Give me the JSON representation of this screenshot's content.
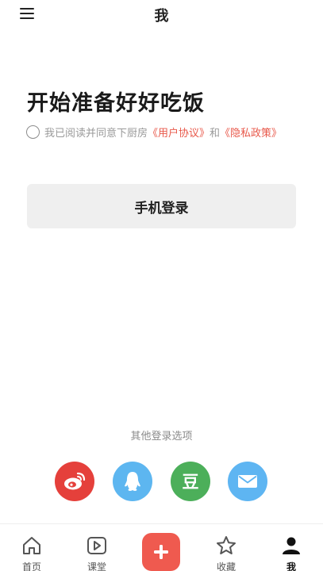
{
  "header": {
    "title": "我",
    "menu_icon": "hamburger-menu-icon"
  },
  "main": {
    "headline": "开始准备好好吃饭",
    "agreement": {
      "prefix": "我已阅读并同意下厨房",
      "user_agreement": "《用户协议》",
      "conjunction": "和",
      "privacy_policy": "《隐私政策》",
      "checked": false
    },
    "login_button": "手机登录",
    "other_login_title": "其他登录选项",
    "social_logins": [
      {
        "name": "weibo",
        "icon": "weibo-icon",
        "color": "#e5403b"
      },
      {
        "name": "qq",
        "icon": "qq-penguin-icon",
        "color": "#5db6f0"
      },
      {
        "name": "douban",
        "icon": "douban-icon",
        "glyph": "豆",
        "color": "#4caf5a"
      },
      {
        "name": "email",
        "icon": "mail-icon",
        "color": "#5eb5f2"
      }
    ]
  },
  "tabbar": {
    "items": [
      {
        "label": "首页",
        "icon": "home-icon"
      },
      {
        "label": "课堂",
        "icon": "play-icon"
      },
      {
        "label": "",
        "icon": "plus-icon",
        "color": "#ef5a4f"
      },
      {
        "label": "收藏",
        "icon": "star-icon"
      },
      {
        "label": "我",
        "icon": "person-icon",
        "active": true
      }
    ]
  },
  "colors": {
    "accent_red": "#e8584a",
    "link": "#e8584a",
    "button_bg": "#efefef"
  }
}
